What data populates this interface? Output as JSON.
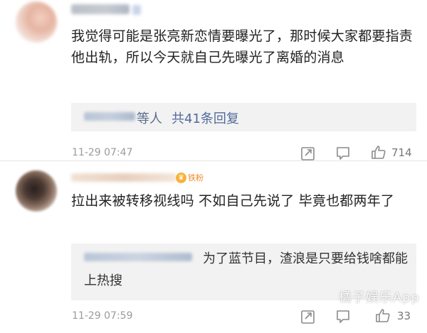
{
  "comments": [
    {
      "text": "我觉得可能是张亮新恋情要曝光了，那时候大家都要指责他出轨，所以今天就自己先曝光了离婚的消息",
      "reply_summary": {
        "suffix": "等人",
        "count_link": "共41条回复"
      },
      "time": "11-29 07:47",
      "like_count": "714"
    },
    {
      "badge": "铁粉",
      "text": "拉出来被转移视线吗 不如自己先说了 毕竟也都两年了",
      "reply": {
        "text": "为了蓝节目，渣浪是只要给钱啥都能上热搜"
      },
      "time": "11-29 07:59",
      "like_count": "33"
    }
  ],
  "watermark": "橘子娱乐App"
}
